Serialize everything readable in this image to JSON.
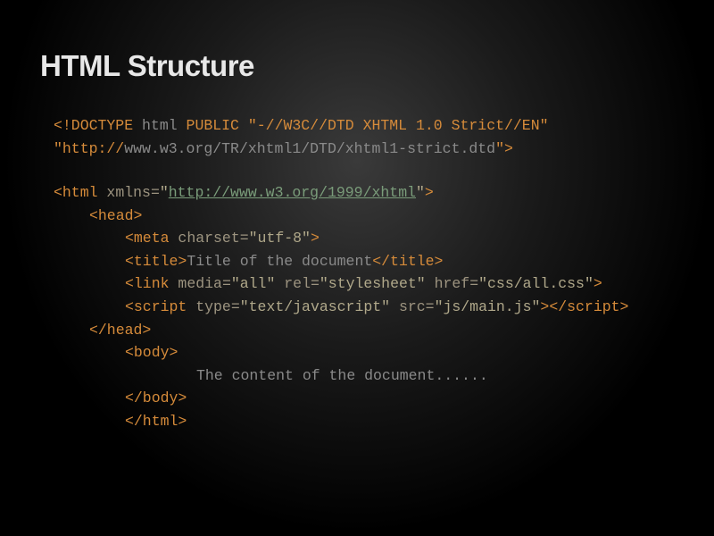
{
  "slide": {
    "title": "HTML Structure",
    "code": {
      "doctype": {
        "open": "<!DOCTYPE",
        "html": " html ",
        "public": "PUBLIC ",
        "fpi": "\"-//W3C//DTD XHTML 1.0 Strict//EN\"",
        "uri1": "\"http://",
        "uri2": "www.w3.org/TR/xhtml1/DTD/xhtml1-strict.dtd",
        "uri3": "\"",
        "close": ">"
      },
      "html_open": {
        "open": "<html",
        "attr": " xmlns",
        "eq": "=",
        "q1": "\"",
        "link": "http://www.w3.org/1999/xhtml",
        "q2": "\"",
        "close": ">"
      },
      "head_open": "<head>",
      "meta": {
        "open": "<meta",
        "attr": " charset",
        "eq": "=",
        "val": "\"utf-8\"",
        "close": ">"
      },
      "title": {
        "open": "<title>",
        "text": "Title of the document",
        "close": "</title>"
      },
      "link": {
        "open": "<link",
        "a1": " media",
        "v1": "\"all\"",
        "a2": " rel",
        "v2": "\"stylesheet\"",
        "a3": " href",
        "v3": "\"css/all.css\"",
        "close": ">"
      },
      "script": {
        "open": "<script",
        "a1": " type",
        "v1": "\"text/javascript\"",
        "a2": " src",
        "v2": "\"js/main.js\"",
        "close1": ">",
        "close2": "</script>"
      },
      "head_close": "</head>",
      "body_open": "<body>",
      "body_text": "The content of the document......",
      "body_close": "</body>",
      "html_close": "</html>"
    }
  }
}
